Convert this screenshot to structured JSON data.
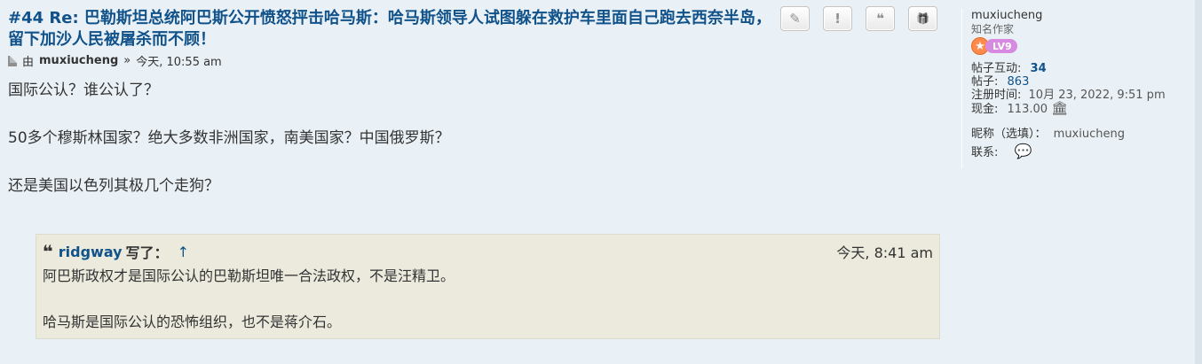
{
  "post": {
    "title": "#44 Re: 巴勒斯坦总统阿巴斯公开愤怒抨击哈马斯：哈马斯领导人试图躲在救护车里面自己跑去西奈半岛，留下加沙人民被屠杀而不顾！",
    "by_label": "由",
    "author": "muxiucheng",
    "time_sep": "»",
    "time": "今天, 10:55 am",
    "paragraphs": [
      "国际公认？谁公认了？",
      "50多个穆斯林国家？绝大多数非洲国家，南美国家？中国俄罗斯？",
      "还是美国以色列其极几个走狗？"
    ],
    "actions": [
      {
        "name": "edit",
        "glyph": "✎"
      },
      {
        "name": "report",
        "glyph": "!"
      },
      {
        "name": "quote",
        "glyph": "❝"
      },
      {
        "name": "thanks",
        "glyph": "🎁"
      }
    ]
  },
  "quote": {
    "author": "ridgway",
    "wrote": "写了：",
    "arrow": "↑",
    "time": "今天, 8:41 am",
    "paragraphs": [
      "阿巴斯政权才是国际公认的巴勒斯坦唯一合法政权，不是汪精卫。",
      "哈马斯是国际公认的恐怖组织，也不是蒋介石。"
    ]
  },
  "sidebar": {
    "username": "muxiucheng",
    "rank": "知名作家",
    "rank_badge": "LV9",
    "rows": [
      {
        "label": "帖子互动:",
        "value": "34"
      },
      {
        "label": "帖子:",
        "value": "863"
      },
      {
        "label": "注册时间:",
        "value": "10月 23, 2022, 9:51 pm"
      },
      {
        "label": "现金:",
        "value": "113.00"
      }
    ],
    "nickname_label": "昵称（选填）：",
    "nickname_value": "muxiucheng",
    "contact_label": "联系:"
  }
}
